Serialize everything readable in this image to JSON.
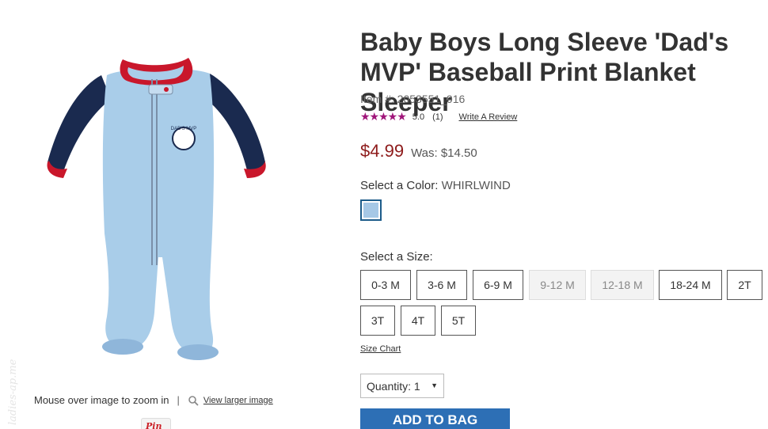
{
  "product": {
    "title": "Baby Boys Long Sleeve 'Dad's MVP' Baseball Print Blanket Sleeper",
    "item_number": "Item #: 2053551_916",
    "rating": {
      "stars": "★★★★★",
      "value": "5.0",
      "count": "(1)",
      "write_review": "Write A Review"
    },
    "price": "$4.99",
    "was_price": "Was: $14.50",
    "image_icon": "blue-baseball-sleeper-image",
    "patch_text": "DAD'S MVP"
  },
  "color": {
    "label": "Select a Color:",
    "selected": "WHIRLWIND",
    "swatch_color": "#a6c8e6"
  },
  "sizes": {
    "label": "Select a Size:",
    "options": [
      {
        "label": "0-3 M",
        "available": true
      },
      {
        "label": "3-6 M",
        "available": true
      },
      {
        "label": "6-9 M",
        "available": true
      },
      {
        "label": "9-12 M",
        "available": false
      },
      {
        "label": "12-18 M",
        "available": false
      },
      {
        "label": "18-24 M",
        "available": true
      },
      {
        "label": "2T",
        "available": true
      },
      {
        "label": "3T",
        "available": true
      },
      {
        "label": "4T",
        "available": true
      },
      {
        "label": "5T",
        "available": true
      }
    ],
    "size_chart": "Size Chart"
  },
  "quantity": {
    "label": "Quantity:",
    "value": "1"
  },
  "add_to_bag": "ADD TO BAG",
  "zoom": {
    "hint": "Mouse over image to zoom in",
    "separator": "|",
    "view_larger": "View larger image"
  },
  "pin_it": "Pin it",
  "watermark": "ladies-ap.me",
  "colors": {
    "price": "#8e1b1b",
    "stars": "#a0157a",
    "button": "#2d6fb5"
  }
}
